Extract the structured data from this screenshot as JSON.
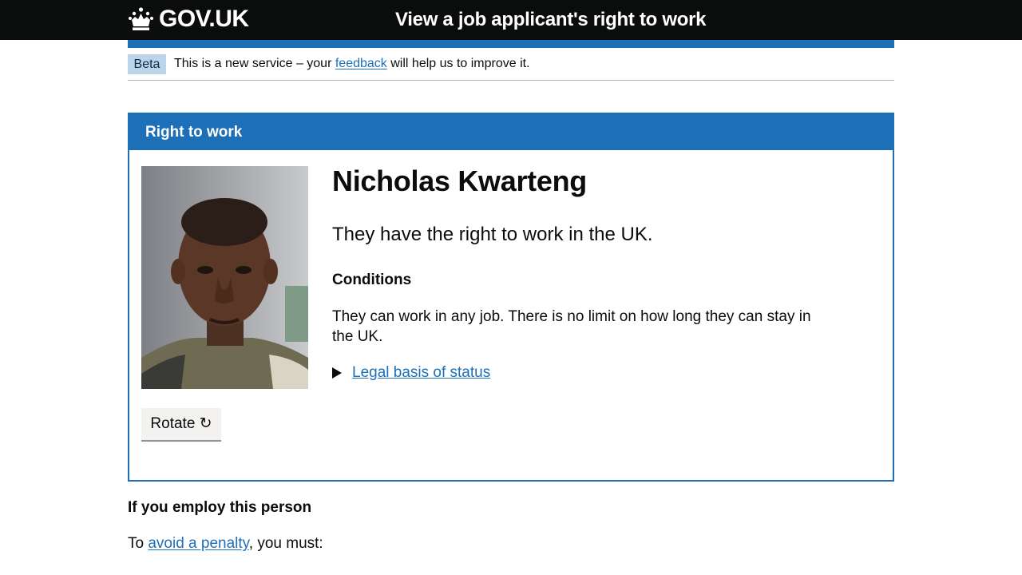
{
  "header": {
    "logo_text": "GOV.UK",
    "service_name": "View a job applicant's right to work",
    "background": "#0b0c0c",
    "accent": "#1d70b8"
  },
  "phase_banner": {
    "tag": "Beta",
    "text_before": "This is a new service – your",
    "link": "feedback",
    "text_after": "will help us to improve it."
  },
  "panel": {
    "title": "Right to work",
    "name": "Nicholas Kwarteng",
    "status": "They have the right to work in the UK.",
    "conditions_heading": "Conditions",
    "conditions_text": "They can work in any job. There is no limit on how long they can stay in the UK.",
    "details_summary": "Legal basis of status",
    "rotate_button": "Rotate ↻"
  },
  "employ": {
    "heading": "If you employ this person",
    "text_before": "To",
    "link": "avoid a penalty",
    "text_after": ", you must:"
  }
}
